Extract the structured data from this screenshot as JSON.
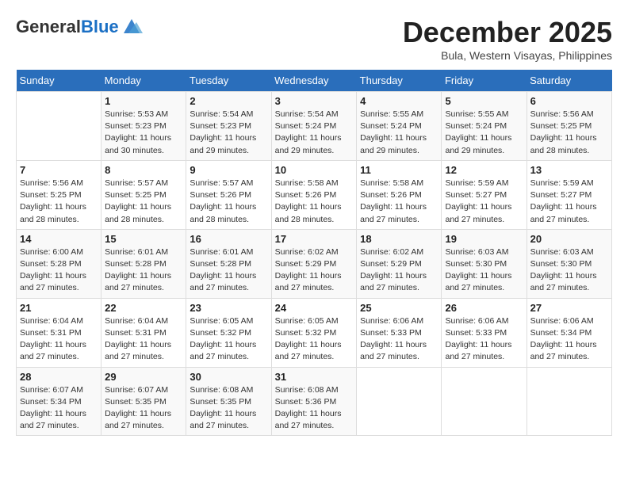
{
  "logo": {
    "general": "General",
    "blue": "Blue"
  },
  "header": {
    "month": "December 2025",
    "location": "Bula, Western Visayas, Philippines"
  },
  "weekdays": [
    "Sunday",
    "Monday",
    "Tuesday",
    "Wednesday",
    "Thursday",
    "Friday",
    "Saturday"
  ],
  "weeks": [
    [
      {
        "day": "",
        "sunrise": "",
        "sunset": "",
        "daylight": ""
      },
      {
        "day": "1",
        "sunrise": "Sunrise: 5:53 AM",
        "sunset": "Sunset: 5:23 PM",
        "daylight": "Daylight: 11 hours and 30 minutes."
      },
      {
        "day": "2",
        "sunrise": "Sunrise: 5:54 AM",
        "sunset": "Sunset: 5:23 PM",
        "daylight": "Daylight: 11 hours and 29 minutes."
      },
      {
        "day": "3",
        "sunrise": "Sunrise: 5:54 AM",
        "sunset": "Sunset: 5:24 PM",
        "daylight": "Daylight: 11 hours and 29 minutes."
      },
      {
        "day": "4",
        "sunrise": "Sunrise: 5:55 AM",
        "sunset": "Sunset: 5:24 PM",
        "daylight": "Daylight: 11 hours and 29 minutes."
      },
      {
        "day": "5",
        "sunrise": "Sunrise: 5:55 AM",
        "sunset": "Sunset: 5:24 PM",
        "daylight": "Daylight: 11 hours and 29 minutes."
      },
      {
        "day": "6",
        "sunrise": "Sunrise: 5:56 AM",
        "sunset": "Sunset: 5:25 PM",
        "daylight": "Daylight: 11 hours and 28 minutes."
      }
    ],
    [
      {
        "day": "7",
        "sunrise": "Sunrise: 5:56 AM",
        "sunset": "Sunset: 5:25 PM",
        "daylight": "Daylight: 11 hours and 28 minutes."
      },
      {
        "day": "8",
        "sunrise": "Sunrise: 5:57 AM",
        "sunset": "Sunset: 5:25 PM",
        "daylight": "Daylight: 11 hours and 28 minutes."
      },
      {
        "day": "9",
        "sunrise": "Sunrise: 5:57 AM",
        "sunset": "Sunset: 5:26 PM",
        "daylight": "Daylight: 11 hours and 28 minutes."
      },
      {
        "day": "10",
        "sunrise": "Sunrise: 5:58 AM",
        "sunset": "Sunset: 5:26 PM",
        "daylight": "Daylight: 11 hours and 28 minutes."
      },
      {
        "day": "11",
        "sunrise": "Sunrise: 5:58 AM",
        "sunset": "Sunset: 5:26 PM",
        "daylight": "Daylight: 11 hours and 27 minutes."
      },
      {
        "day": "12",
        "sunrise": "Sunrise: 5:59 AM",
        "sunset": "Sunset: 5:27 PM",
        "daylight": "Daylight: 11 hours and 27 minutes."
      },
      {
        "day": "13",
        "sunrise": "Sunrise: 5:59 AM",
        "sunset": "Sunset: 5:27 PM",
        "daylight": "Daylight: 11 hours and 27 minutes."
      }
    ],
    [
      {
        "day": "14",
        "sunrise": "Sunrise: 6:00 AM",
        "sunset": "Sunset: 5:28 PM",
        "daylight": "Daylight: 11 hours and 27 minutes."
      },
      {
        "day": "15",
        "sunrise": "Sunrise: 6:01 AM",
        "sunset": "Sunset: 5:28 PM",
        "daylight": "Daylight: 11 hours and 27 minutes."
      },
      {
        "day": "16",
        "sunrise": "Sunrise: 6:01 AM",
        "sunset": "Sunset: 5:28 PM",
        "daylight": "Daylight: 11 hours and 27 minutes."
      },
      {
        "day": "17",
        "sunrise": "Sunrise: 6:02 AM",
        "sunset": "Sunset: 5:29 PM",
        "daylight": "Daylight: 11 hours and 27 minutes."
      },
      {
        "day": "18",
        "sunrise": "Sunrise: 6:02 AM",
        "sunset": "Sunset: 5:29 PM",
        "daylight": "Daylight: 11 hours and 27 minutes."
      },
      {
        "day": "19",
        "sunrise": "Sunrise: 6:03 AM",
        "sunset": "Sunset: 5:30 PM",
        "daylight": "Daylight: 11 hours and 27 minutes."
      },
      {
        "day": "20",
        "sunrise": "Sunrise: 6:03 AM",
        "sunset": "Sunset: 5:30 PM",
        "daylight": "Daylight: 11 hours and 27 minutes."
      }
    ],
    [
      {
        "day": "21",
        "sunrise": "Sunrise: 6:04 AM",
        "sunset": "Sunset: 5:31 PM",
        "daylight": "Daylight: 11 hours and 27 minutes."
      },
      {
        "day": "22",
        "sunrise": "Sunrise: 6:04 AM",
        "sunset": "Sunset: 5:31 PM",
        "daylight": "Daylight: 11 hours and 27 minutes."
      },
      {
        "day": "23",
        "sunrise": "Sunrise: 6:05 AM",
        "sunset": "Sunset: 5:32 PM",
        "daylight": "Daylight: 11 hours and 27 minutes."
      },
      {
        "day": "24",
        "sunrise": "Sunrise: 6:05 AM",
        "sunset": "Sunset: 5:32 PM",
        "daylight": "Daylight: 11 hours and 27 minutes."
      },
      {
        "day": "25",
        "sunrise": "Sunrise: 6:06 AM",
        "sunset": "Sunset: 5:33 PM",
        "daylight": "Daylight: 11 hours and 27 minutes."
      },
      {
        "day": "26",
        "sunrise": "Sunrise: 6:06 AM",
        "sunset": "Sunset: 5:33 PM",
        "daylight": "Daylight: 11 hours and 27 minutes."
      },
      {
        "day": "27",
        "sunrise": "Sunrise: 6:06 AM",
        "sunset": "Sunset: 5:34 PM",
        "daylight": "Daylight: 11 hours and 27 minutes."
      }
    ],
    [
      {
        "day": "28",
        "sunrise": "Sunrise: 6:07 AM",
        "sunset": "Sunset: 5:34 PM",
        "daylight": "Daylight: 11 hours and 27 minutes."
      },
      {
        "day": "29",
        "sunrise": "Sunrise: 6:07 AM",
        "sunset": "Sunset: 5:35 PM",
        "daylight": "Daylight: 11 hours and 27 minutes."
      },
      {
        "day": "30",
        "sunrise": "Sunrise: 6:08 AM",
        "sunset": "Sunset: 5:35 PM",
        "daylight": "Daylight: 11 hours and 27 minutes."
      },
      {
        "day": "31",
        "sunrise": "Sunrise: 6:08 AM",
        "sunset": "Sunset: 5:36 PM",
        "daylight": "Daylight: 11 hours and 27 minutes."
      },
      {
        "day": "",
        "sunrise": "",
        "sunset": "",
        "daylight": ""
      },
      {
        "day": "",
        "sunrise": "",
        "sunset": "",
        "daylight": ""
      },
      {
        "day": "",
        "sunrise": "",
        "sunset": "",
        "daylight": ""
      }
    ]
  ]
}
